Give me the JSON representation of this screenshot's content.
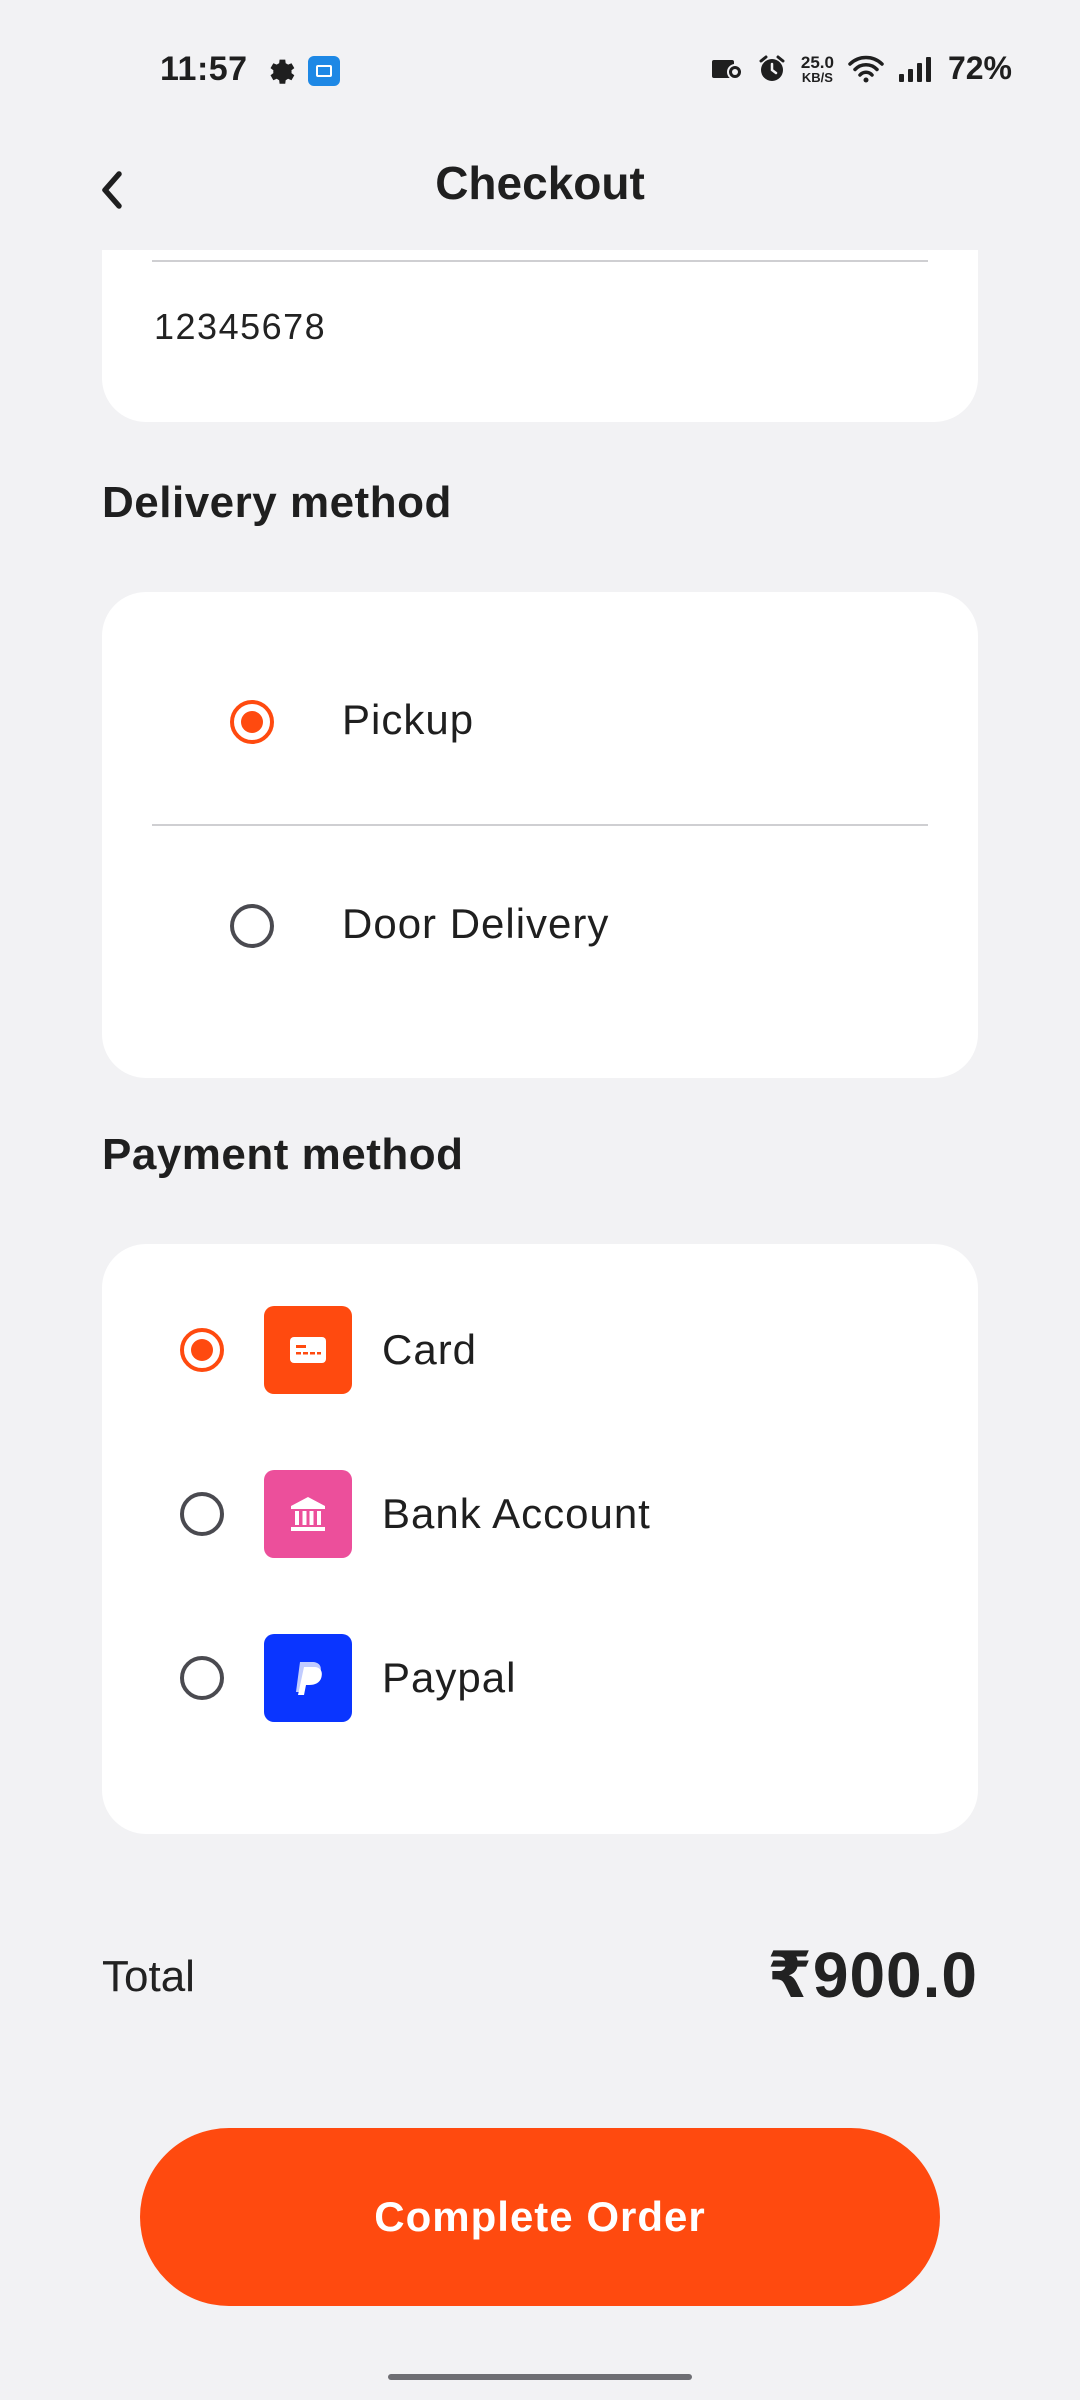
{
  "status_bar": {
    "time": "11:57",
    "net_speed_value": "25.0",
    "net_speed_unit": "KB/S",
    "battery": "72%"
  },
  "header": {
    "title": "Checkout"
  },
  "contact": {
    "phone": "12345678"
  },
  "delivery": {
    "title": "Delivery method",
    "options": [
      {
        "label": "Pickup",
        "selected": true
      },
      {
        "label": "Door Delivery",
        "selected": false
      }
    ]
  },
  "payment": {
    "title": "Payment method",
    "options": [
      {
        "label": "Card",
        "selected": true,
        "icon": "card-icon",
        "icon_color": "#ff4a0f"
      },
      {
        "label": "Bank Account",
        "selected": false,
        "icon": "bank-icon",
        "icon_color": "#ec4f9b"
      },
      {
        "label": "Paypal",
        "selected": false,
        "icon": "paypal-icon",
        "icon_color": "#0a35ff"
      }
    ]
  },
  "summary": {
    "total_label": "Total",
    "total_value": "₹900.0"
  },
  "actions": {
    "complete_order": "Complete Order"
  },
  "colors": {
    "accent": "#ff4a0f",
    "background": "#f2f2f4",
    "card": "#ffffff"
  }
}
